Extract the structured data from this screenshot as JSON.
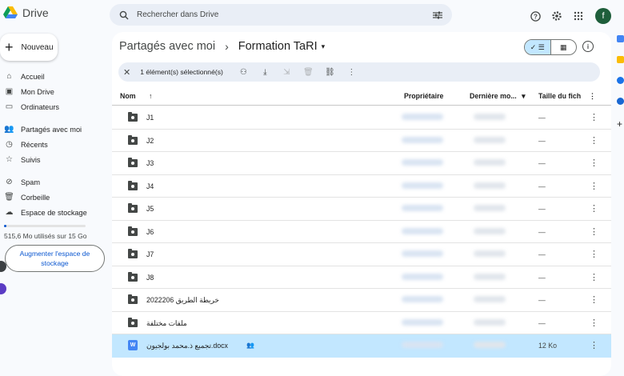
{
  "app": {
    "name": "Drive"
  },
  "search": {
    "placeholder": "Rechercher dans Drive"
  },
  "account": {
    "initial": "f"
  },
  "new_button": {
    "label": "Nouveau"
  },
  "nav": {
    "items": [
      {
        "label": "Accueil",
        "icon": "home-icon"
      },
      {
        "label": "Mon Drive",
        "icon": "drive-icon"
      },
      {
        "label": "Ordinateurs",
        "icon": "computer-icon"
      },
      {
        "label": "Partagés avec moi",
        "icon": "people-icon"
      },
      {
        "label": "Récents",
        "icon": "clock-icon"
      },
      {
        "label": "Suivis",
        "icon": "star-icon"
      },
      {
        "label": "Spam",
        "icon": "spam-icon"
      },
      {
        "label": "Corbeille",
        "icon": "trash-icon"
      },
      {
        "label": "Espace de stockage",
        "icon": "cloud-icon"
      }
    ]
  },
  "storage": {
    "used_fraction": 0.034,
    "text": "515,6 Mo utilisés sur 15 Go",
    "upgrade_label": "Augmenter l'espace de stockage"
  },
  "breadcrumb": {
    "parent": "Partagés avec moi",
    "current": "Formation TaRI"
  },
  "selection": {
    "text": "1 élément(s) sélectionné(s)"
  },
  "table": {
    "headers": {
      "name": "Nom",
      "owner": "Propriétaire",
      "modified": "Dernière mo...",
      "size": "Taille du fich"
    },
    "rows": [
      {
        "name": "J1",
        "type": "folder",
        "size": "—"
      },
      {
        "name": "J2",
        "type": "folder",
        "size": "—"
      },
      {
        "name": "J3",
        "type": "folder",
        "size": "—"
      },
      {
        "name": "J4",
        "type": "folder",
        "size": "—"
      },
      {
        "name": "J5",
        "type": "folder",
        "size": "—"
      },
      {
        "name": "J6",
        "type": "folder",
        "size": "—"
      },
      {
        "name": "J7",
        "type": "folder",
        "size": "—"
      },
      {
        "name": "J8",
        "type": "folder",
        "size": "—"
      },
      {
        "name": "خريطة الطريق 2022206",
        "type": "folder",
        "size": "—"
      },
      {
        "name": "ملفات مختلفة",
        "type": "folder",
        "size": "—"
      },
      {
        "name": "تجميع ذ.محمد بولجيون.docx",
        "type": "word",
        "size": "12 Ko",
        "selected": true,
        "shared": true
      }
    ]
  },
  "colors": {
    "accent": "#0b57d0",
    "selected_row": "#c2e7ff",
    "search_bg": "#e9eef6"
  }
}
